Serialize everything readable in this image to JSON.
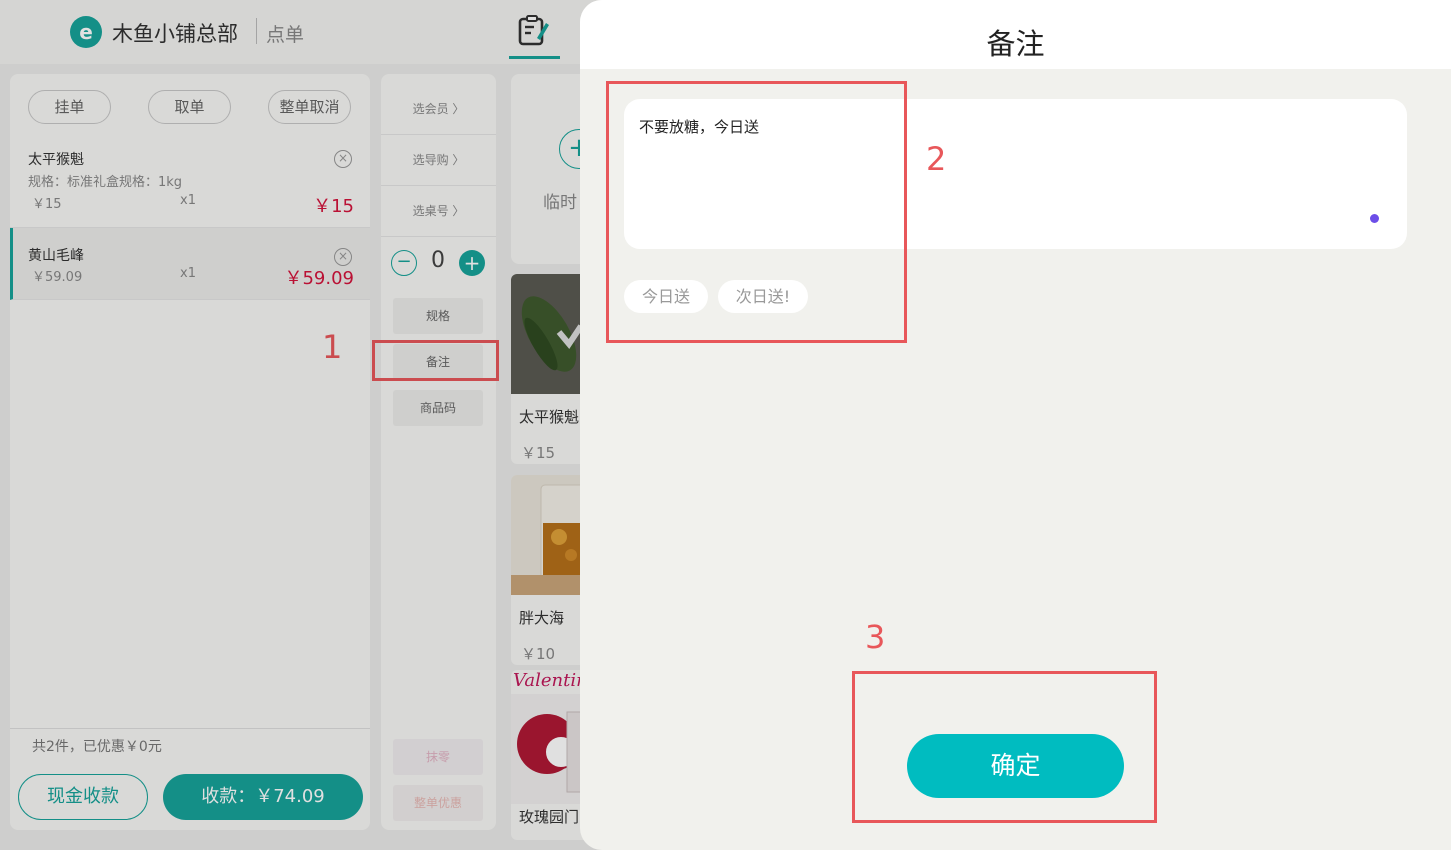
{
  "header": {
    "store_name": "木鱼小铺总部",
    "page_name": "点单"
  },
  "cart": {
    "buttons": [
      "挂单",
      "取单",
      "整单取消"
    ],
    "items": [
      {
        "name": "太平猴魁",
        "spec": "规格：标准礼盒规格：1kg",
        "price": "￥15",
        "qty": "x1",
        "total": "￥15"
      },
      {
        "name": "黄山毛峰",
        "spec": "",
        "price": "￥59.09",
        "qty": "x1",
        "total": "￥59.09"
      }
    ],
    "summary": "共2件，已优惠￥0元",
    "cash_label": "现金收款",
    "pay_label": "收款：￥74.09"
  },
  "actions": {
    "links": [
      "选会员 〉",
      "选导购 〉",
      "选桌号 〉"
    ],
    "stepper_value": "0",
    "buttons": [
      "规格",
      "备注",
      "商品码"
    ],
    "bottom_buttons": [
      "抹零",
      "整单优惠"
    ]
  },
  "products": {
    "temp_label": "临时",
    "cards": [
      {
        "name": "太平猴魁",
        "price": "￥15"
      },
      {
        "name": "胖大海",
        "price": "￥10"
      },
      {
        "name": "玫瑰园门",
        "banner": "Valentin"
      }
    ]
  },
  "annotations": [
    "1",
    "2",
    "3"
  ],
  "modal": {
    "title": "备注",
    "note_text": "不要放糖，今日送",
    "chips": [
      "今日送",
      "次日送!"
    ],
    "confirm_label": "确定"
  },
  "colors": {
    "accent": "#17a39a",
    "confirm": "#00bcc0",
    "price_red": "#d4143c",
    "highlight": "#e8575a"
  }
}
